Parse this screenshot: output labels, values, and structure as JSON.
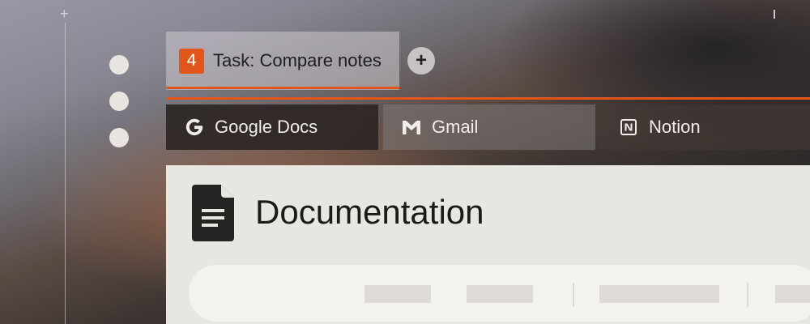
{
  "task_tab": {
    "number": "4",
    "label": "Task: Compare notes"
  },
  "add_tab_symbol": "+",
  "app_tabs": [
    {
      "label": "Google Docs",
      "icon": "google-icon"
    },
    {
      "label": "Gmail",
      "icon": "gmail-icon"
    },
    {
      "label": "Notion",
      "icon": "notion-icon"
    }
  ],
  "document": {
    "title": "Documentation",
    "icon": "document-icon"
  },
  "colors": {
    "accent": "#e2561b",
    "panel": "#e8e6e1",
    "active_tab": "#2d2624"
  }
}
